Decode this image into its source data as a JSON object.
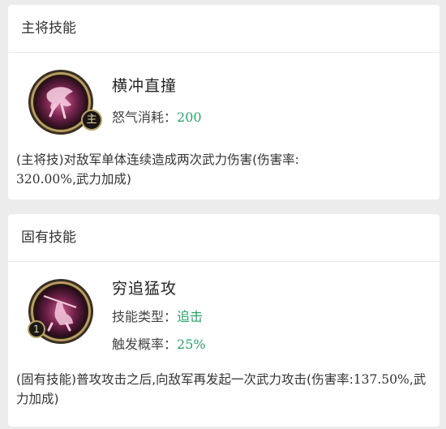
{
  "main_skill": {
    "section_title": "主将技能",
    "name": "横冲直撞",
    "badge": "主",
    "cost_label": "怒气消耗：",
    "cost_value": "200",
    "desc_prefix": "(主将技)对敌军单体连续造成两次武力伤害(伤害率:",
    "desc_rate": "320.00%",
    "desc_suffix": ",武力加成)"
  },
  "innate_skill": {
    "section_title": "固有技能",
    "name": "穷追猛攻",
    "badge": "1",
    "type_label": "技能类型：",
    "type_value": "追击",
    "prob_label": "触发概率：",
    "prob_value": "25%",
    "desc_prefix": "(固有技能)普攻攻击之后,向敌军再发起一次武力攻击(伤害率:",
    "desc_rate": "137.50%",
    "desc_suffix": ",武力加成)"
  },
  "colors": {
    "value_green": "#2aa36b",
    "card_bg": "#ffffff",
    "page_bg": "#ececec"
  },
  "icons": {
    "main_skill": "charging-warrior-skill-icon",
    "innate_skill": "spear-rider-skill-icon"
  }
}
